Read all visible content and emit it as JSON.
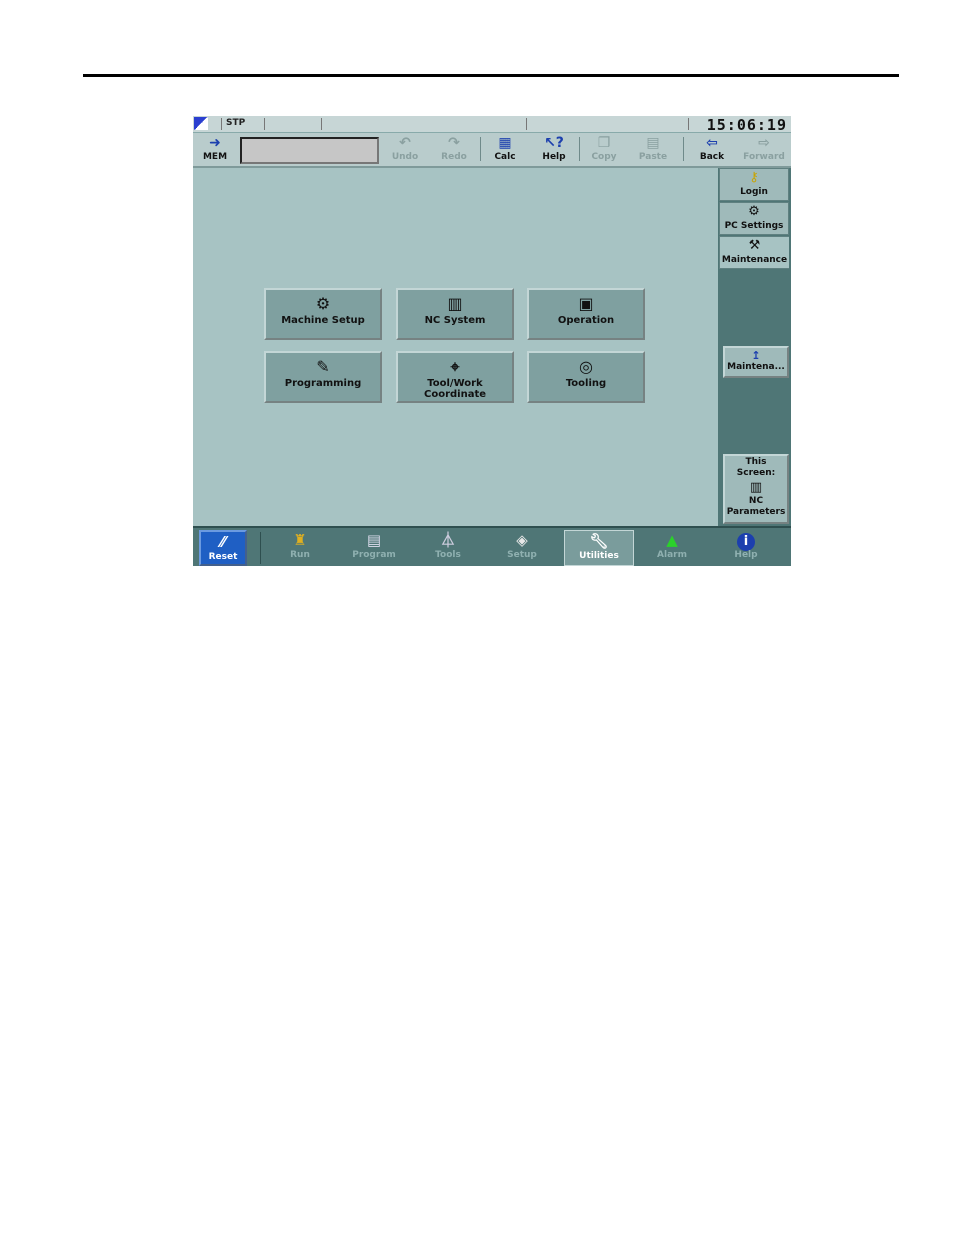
{
  "status": {
    "mode": "STP",
    "clock": "15:06:19"
  },
  "toolbar": {
    "mem": "MEM",
    "undo": "Undo",
    "redo": "Redo",
    "calc": "Calc",
    "help": "Help",
    "copy": "Copy",
    "paste": "Paste",
    "back": "Back",
    "forward": "Forward"
  },
  "main": {
    "buttons": [
      {
        "label": "Machine Setup",
        "icon": "machine-icon"
      },
      {
        "label": "NC System",
        "icon": "nc-system-icon"
      },
      {
        "label": "Operation",
        "icon": "operation-icon"
      },
      {
        "label": "Programming",
        "icon": "programming-icon"
      },
      {
        "label": "Tool/Work Coordinate",
        "icon": "tool-work-icon"
      },
      {
        "label": "Tooling",
        "icon": "tooling-icon"
      }
    ]
  },
  "right": {
    "tabs": [
      "Login",
      "PC Settings",
      "Maintenance"
    ],
    "mainten_button": "Maintena...",
    "this_screen": "This Screen:",
    "screen_name": "NC Parameters"
  },
  "bottom": {
    "items": [
      "Reset",
      "Run",
      "Program",
      "Tools",
      "Setup",
      "Utilities",
      "Alarm",
      "Help"
    ],
    "active": "Utilities"
  },
  "colors": {
    "background": "#a7c3c3",
    "panel": "#4f7676",
    "reset_blue": "#1f5fc4"
  }
}
